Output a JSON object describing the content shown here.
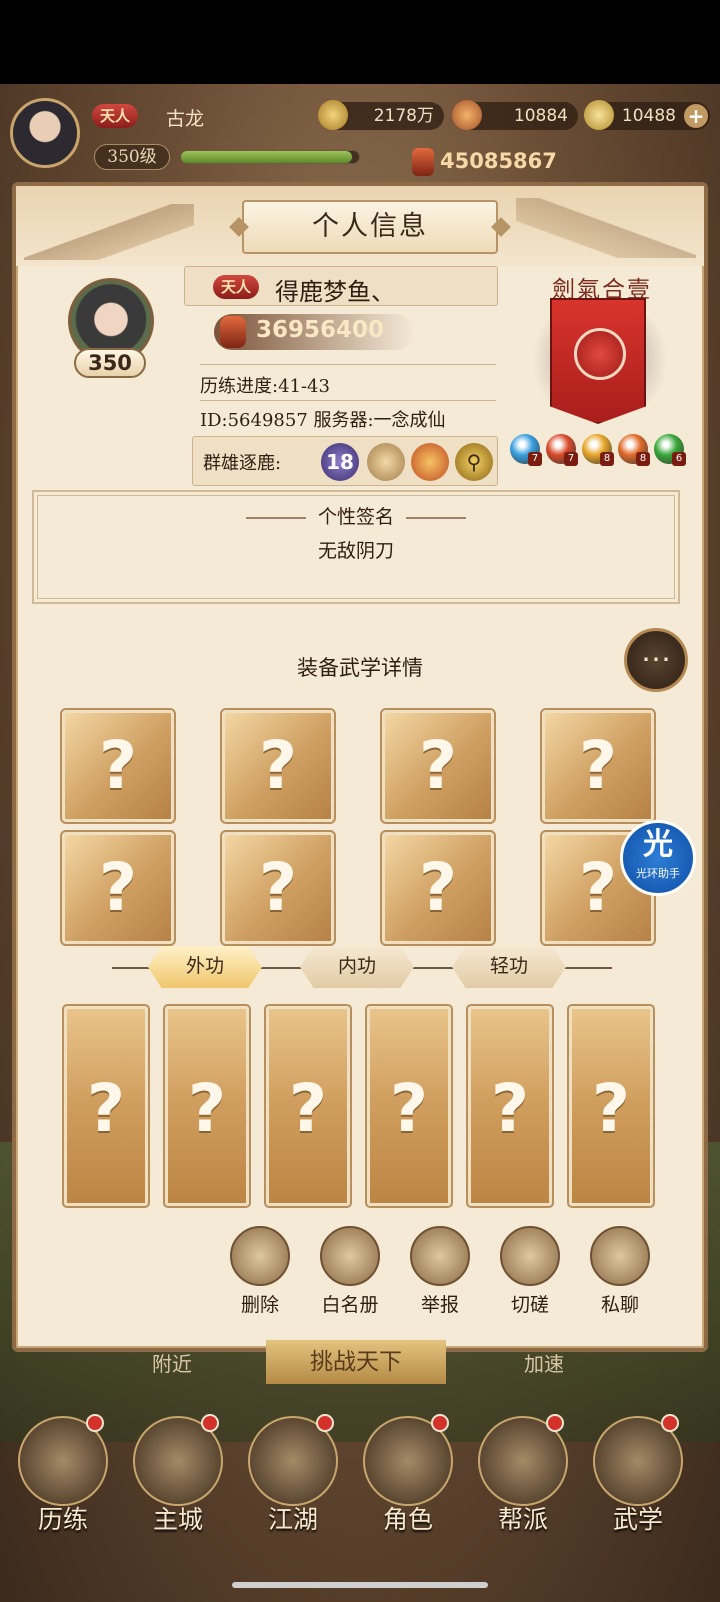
{
  "top_bar": {
    "rank_badge": "天人",
    "player_name": "古龙",
    "level": "350级",
    "exp_fraction": 0.96,
    "power": "45085867",
    "resources": [
      {
        "icon": "copper-coin-icon",
        "value": "2178万"
      },
      {
        "icon": "ingot-icon",
        "value": "10884"
      },
      {
        "icon": "gold-ingot-icon",
        "value": "10488"
      }
    ]
  },
  "panel": {
    "title": "个人信息",
    "profile": {
      "level": "350",
      "rank_badge": "天人",
      "name": "得鹿梦鱼、",
      "power": "36956400",
      "progress": "历练进度:41-43",
      "id_server": "ID:5649857   服务器:一念成仙",
      "qxzl_label": "群雄逐鹿:",
      "qxzl_rank": "18"
    },
    "sect_title": "劍氣合壹",
    "gems": [
      {
        "icon": "blue-gem-icon",
        "level": "7",
        "color": "#3aa0e0"
      },
      {
        "icon": "red-gem-icon",
        "level": "7",
        "color": "#d84a2a"
      },
      {
        "icon": "gold-gem-icon",
        "level": "8",
        "color": "#e8a62a"
      },
      {
        "icon": "orange-gem-icon",
        "level": "8",
        "color": "#e06a2a"
      },
      {
        "icon": "green-gem-icon",
        "level": "6",
        "color": "#3aa83a"
      }
    ],
    "signature": {
      "title": "个性签名",
      "text": "无敌阴刀"
    },
    "equip_title": "装备武学详情",
    "slot_glyph": "?",
    "tabs": [
      {
        "label": "外功",
        "active": true
      },
      {
        "label": "内功",
        "active": false
      },
      {
        "label": "轻功",
        "active": false
      }
    ],
    "actions": [
      {
        "label": "删除",
        "icon": "delete-user-icon"
      },
      {
        "label": "白名册",
        "icon": "whitelist-book-icon"
      },
      {
        "label": "举报",
        "icon": "report-book-icon"
      },
      {
        "label": "切磋",
        "icon": "spar-icon"
      },
      {
        "label": "私聊",
        "icon": "private-chat-icon"
      }
    ]
  },
  "overlay": {
    "badge_big": "光",
    "badge_small": "光环助手"
  },
  "behind": {
    "left": "附近",
    "center": "挑战天下",
    "right": "加速"
  },
  "nav": [
    {
      "label": "历练",
      "icon": "training-icon"
    },
    {
      "label": "主城",
      "icon": "city-icon"
    },
    {
      "label": "江湖",
      "icon": "jianghu-icon"
    },
    {
      "label": "角色",
      "icon": "character-icon"
    },
    {
      "label": "帮派",
      "icon": "guild-icon"
    },
    {
      "label": "武学",
      "icon": "martial-scroll-icon"
    }
  ]
}
